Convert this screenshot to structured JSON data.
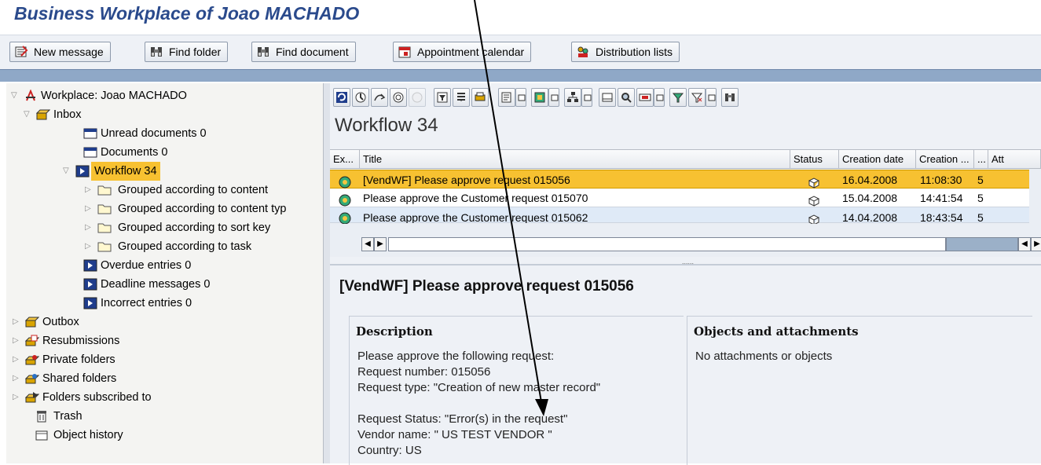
{
  "window": {
    "title": "Business Workplace of Joao MACHADO"
  },
  "app_toolbar": {
    "buttons": [
      {
        "label": "New message",
        "icon": "new-message-icon"
      },
      {
        "label": "Find folder",
        "icon": "binoculars-icon"
      },
      {
        "label": "Find document",
        "icon": "binoculars-icon"
      },
      {
        "label": "Appointment calendar",
        "icon": "calendar-icon"
      },
      {
        "label": "Distribution lists",
        "icon": "distribution-list-icon"
      }
    ]
  },
  "tree": {
    "root": "Workplace: Joao MACHADO",
    "inbox": "Inbox",
    "unread": "Unread documents 0",
    "documents": "Documents 0",
    "workflow": "Workflow 34",
    "grouped": [
      "Grouped according to content",
      "Grouped according to content typ",
      "Grouped according to sort key",
      "Grouped according to task"
    ],
    "overdue": "Overdue entries 0",
    "deadline": "Deadline messages 0",
    "incorrect": "Incorrect entries 0",
    "outbox": "Outbox",
    "resubmissions": "Resubmissions",
    "private": "Private folders",
    "shared": "Shared folders",
    "subscribed": "Folders subscribed to",
    "trash": "Trash",
    "history": "Object history"
  },
  "workflow_view": {
    "title": "Workflow 34",
    "columns": {
      "ex": "Ex...",
      "title": "Title",
      "status": "Status",
      "creation_date": "Creation date",
      "creation_time": "Creation ...",
      "c6": "...",
      "att": "Att"
    },
    "rows": [
      {
        "title": "[VendWF] Please approve request 015056",
        "date": "16.04.2008",
        "time": "11:08:30",
        "num": "5"
      },
      {
        "title": "Please approve the Customer request 015070",
        "date": "15.04.2008",
        "time": "14:41:54",
        "num": "5"
      },
      {
        "title": "Please approve the Customer request 015062",
        "date": "14.04.2008",
        "time": "18:43:54",
        "num": "5"
      }
    ],
    "sash_dots": "......"
  },
  "preview": {
    "title": "[VendWF] Please approve request 015056",
    "description_heading": "Description",
    "description_lines": [
      "Please approve the following request:",
      "Request number: 015056",
      "Request type: \"Creation of new master record\"",
      "",
      "Request Status: \"Error(s) in the request\"",
      "Vendor name: \" US TEST VENDOR \"",
      "Country: US"
    ],
    "objects_heading": "Objects and attachments",
    "objects_text": "No attachments or objects"
  },
  "colors": {
    "title": "#2a4a8c",
    "selection": "#f7c131",
    "band": "#8fa8c7",
    "row_alt": "#dfeaf7"
  }
}
